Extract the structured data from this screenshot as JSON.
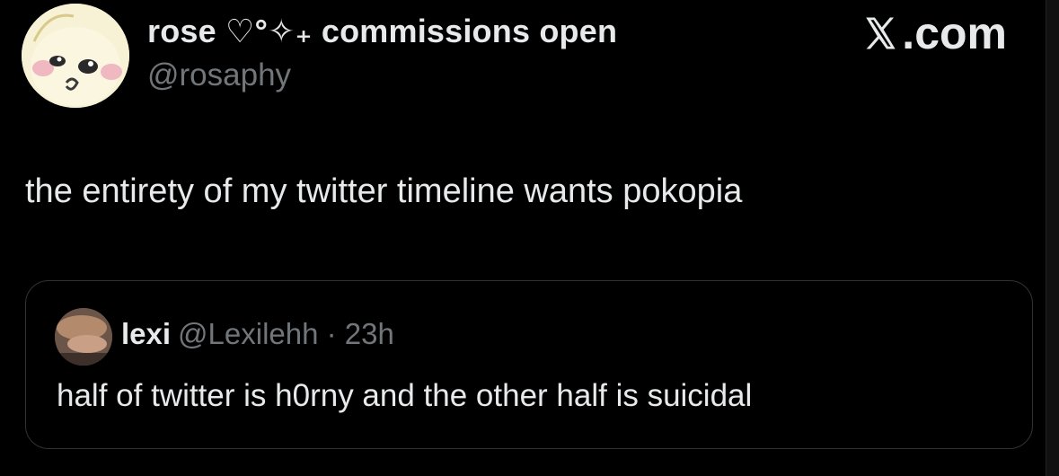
{
  "tweet": {
    "author": {
      "display_name": "rose ♡°✧₊ commissions open",
      "handle": "@rosaphy"
    },
    "text": "the entirety of my twitter timeline wants pokopia"
  },
  "brand": {
    "label": ".com",
    "icon": "x-logo-icon"
  },
  "quote": {
    "author_name": "lexi",
    "author_handle_time": "@Lexilehh · 23h",
    "text": "half of twitter is h0rny and the other half is suicidal"
  },
  "colors": {
    "background": "#000000",
    "primary_text": "#e7e9ea",
    "secondary_text": "#71767b",
    "border": "#2f3336"
  }
}
